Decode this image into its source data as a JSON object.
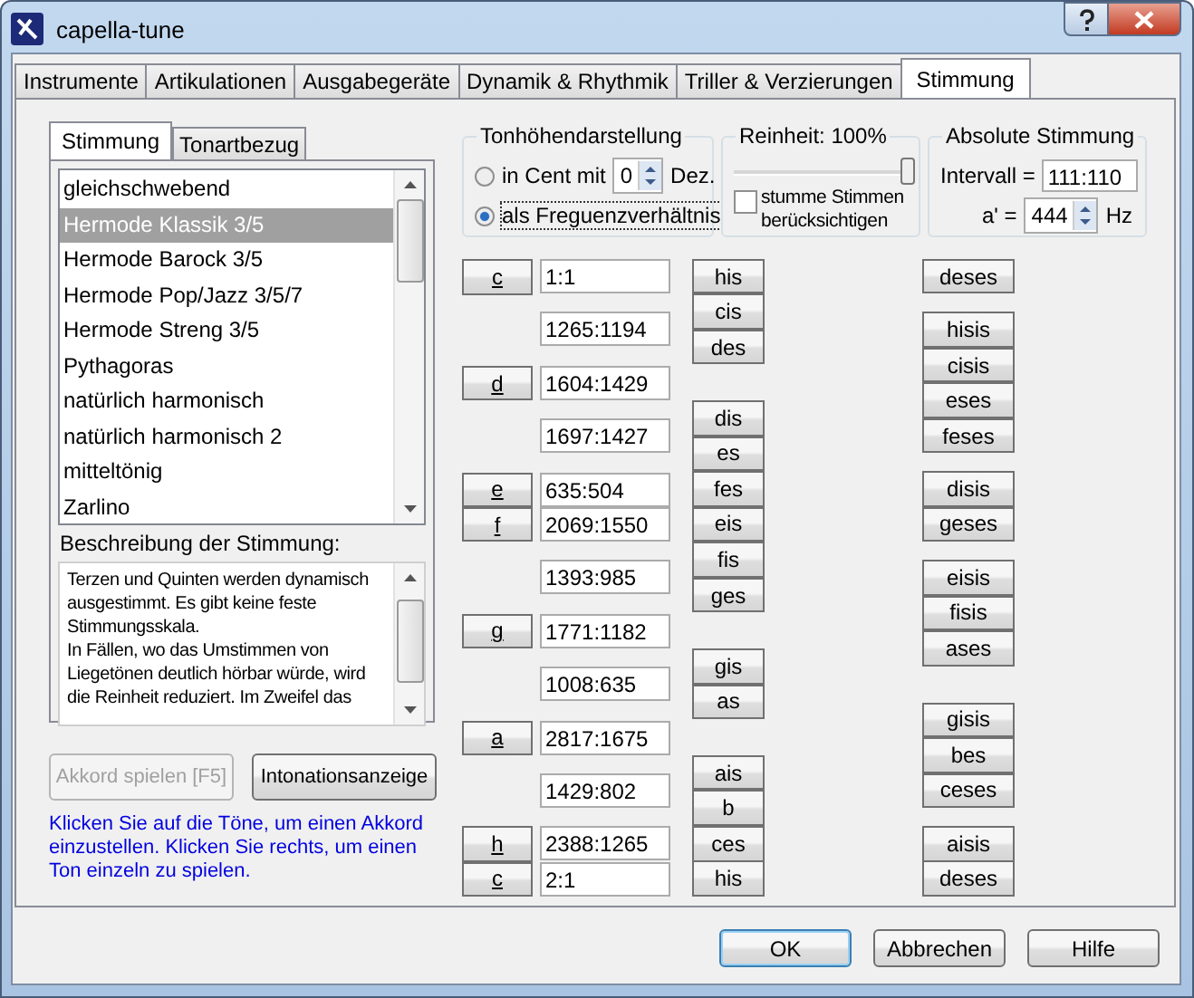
{
  "window": {
    "title": "capella-tune"
  },
  "tabs": [
    {
      "label": "Instrumente",
      "selected": false
    },
    {
      "label": "Artikulationen",
      "selected": false
    },
    {
      "label": "Ausgabegeräte",
      "selected": false
    },
    {
      "label": "Dynamik & Rhythmik",
      "selected": false
    },
    {
      "label": "Triller & Verzierungen",
      "selected": false
    },
    {
      "label": "Stimmung",
      "selected": true
    }
  ],
  "sub_tabs": [
    {
      "label": "Stimmung",
      "selected": true
    },
    {
      "label": "Tonartbezug",
      "selected": false
    }
  ],
  "tunings": [
    {
      "label": "gleichschwebend",
      "selected": false
    },
    {
      "label": "Hermode Klassik 3/5",
      "selected": true
    },
    {
      "label": "Hermode Barock 3/5",
      "selected": false
    },
    {
      "label": "Hermode Pop/Jazz 3/5/7",
      "selected": false
    },
    {
      "label": "Hermode Streng 3/5",
      "selected": false
    },
    {
      "label": "Pythagoras",
      "selected": false
    },
    {
      "label": "natürlich harmonisch",
      "selected": false
    },
    {
      "label": "natürlich harmonisch 2",
      "selected": false
    },
    {
      "label": "mitteltönig",
      "selected": false
    },
    {
      "label": "Zarlino",
      "selected": false
    }
  ],
  "description": {
    "label": "Beschreibung der Stimmung:",
    "text": "Terzen und Quinten werden dynamisch ausgestimmt. Es gibt keine feste Stimmungsskala.\nIn Fällen, wo das Umstimmen von Liegetönen deutlich hörbar würde, wird die Reinheit reduziert. Im Zweifel das"
  },
  "actions": [
    {
      "label": "Akkord spielen [F5]",
      "disabled": true
    },
    {
      "label": "Intonationsanzeige",
      "disabled": false
    }
  ],
  "hint": "Klicken Sie auf die Töne, um einen Akkord einzustellen. Klicken Sie rechts, um einen Ton einzeln zu spielen.",
  "pitch_display": {
    "title": "Tonhöhendarstellung",
    "cent_option": {
      "label": "in Cent mit",
      "selected": false
    },
    "decimals": "0",
    "decimals_unit": "Dez.",
    "ratio_option": {
      "label": "als Freguenzverhältnis",
      "selected": true
    }
  },
  "purity": {
    "title": "Reinheit: 100%",
    "level": 1,
    "mute_voices": {
      "label": "stumme Stimmen berücksichtigen",
      "checked": false
    }
  },
  "absolute": {
    "title": "Absolute Stimmung",
    "interval_label": "Intervall =",
    "interval": "111:110",
    "a_label": "a' =",
    "a_value": "444",
    "unit": "Hz"
  },
  "steps": [
    {
      "note": "c",
      "ratio": "1:1",
      "enharmonics": [
        "his"
      ],
      "double_accidentals": [
        "deses"
      ]
    },
    {
      "ratio": "1265:1194",
      "enharmonics": [
        "cis",
        "des"
      ],
      "double_accidentals": [
        "hisis"
      ]
    },
    {
      "note": "d",
      "ratio": "1604:1429",
      "double_accidentals": [
        "cisis",
        "eses"
      ]
    },
    {
      "ratio": "1697:1427",
      "enharmonics": [
        "dis",
        "es"
      ],
      "double_accidentals": [
        "feses"
      ]
    },
    {
      "note": "e",
      "ratio": "635:504",
      "enharmonics": [
        "fes"
      ],
      "double_accidentals": [
        "disis"
      ]
    },
    {
      "note": "f",
      "ratio": "2069:1550",
      "enharmonics": [
        "eis"
      ],
      "double_accidentals": [
        "geses"
      ]
    },
    {
      "ratio": "1393:985",
      "enharmonics": [
        "fis",
        "ges"
      ],
      "double_accidentals": [
        "eisis"
      ]
    },
    {
      "note": "g",
      "ratio": "1771:1182",
      "double_accidentals": [
        "fisis",
        "ases"
      ]
    },
    {
      "ratio": "1008:635",
      "enharmonics": [
        "gis",
        "as"
      ]
    },
    {
      "note": "a",
      "ratio": "2817:1675",
      "double_accidentals": [
        "gisis",
        "bes"
      ]
    },
    {
      "ratio": "1429:802",
      "enharmonics": [
        "ais",
        "b"
      ],
      "double_accidentals": [
        "ceses"
      ]
    },
    {
      "note": "h",
      "ratio": "2388:1265",
      "enharmonics": [
        "ces"
      ],
      "double_accidentals": [
        "aisis"
      ]
    },
    {
      "note": "c",
      "ratio": "2:1",
      "enharmonics": [
        "his"
      ],
      "double_accidentals": [
        "deses"
      ]
    }
  ],
  "dialog_buttons": [
    {
      "label": "OK",
      "default": true
    },
    {
      "label": "Abbrechen",
      "default": false
    },
    {
      "label": "Hilfe",
      "default": false
    }
  ]
}
